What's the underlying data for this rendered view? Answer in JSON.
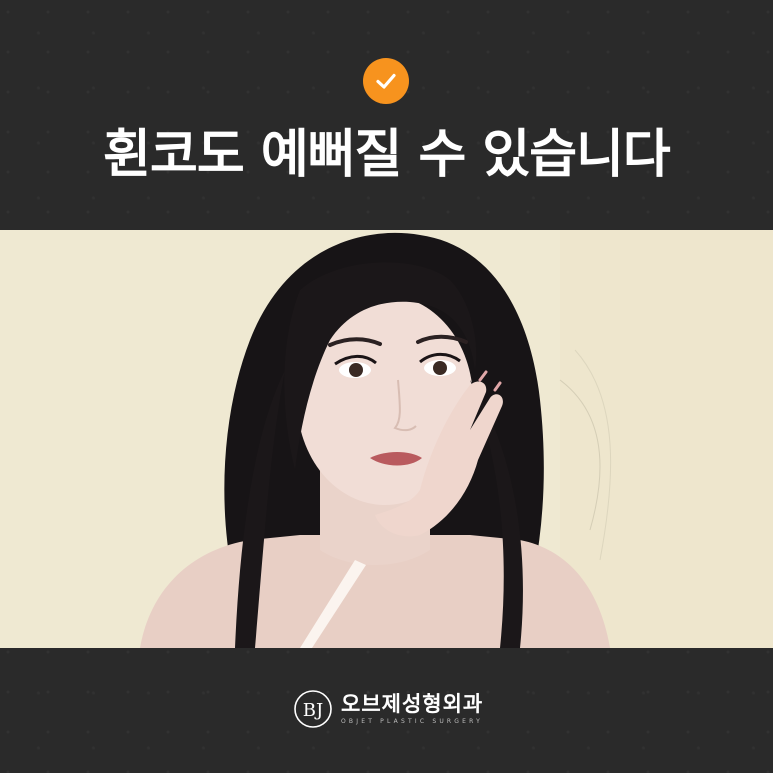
{
  "header": {
    "badge_icon": "check-icon",
    "badge_color": "#f7931e",
    "headline": "휜코도 예뻐질 수 있습니다"
  },
  "photo": {
    "description_icon": "portrait-photo",
    "background_color": "#efe9d2"
  },
  "footer": {
    "logo_icon": "objet-logo-mark",
    "logo_name": "오브제성형외과",
    "logo_sub": "OBJET PLASTIC SURGERY"
  },
  "colors": {
    "background": "#2a2a2a",
    "accent": "#f7931e",
    "text": "#ffffff"
  }
}
